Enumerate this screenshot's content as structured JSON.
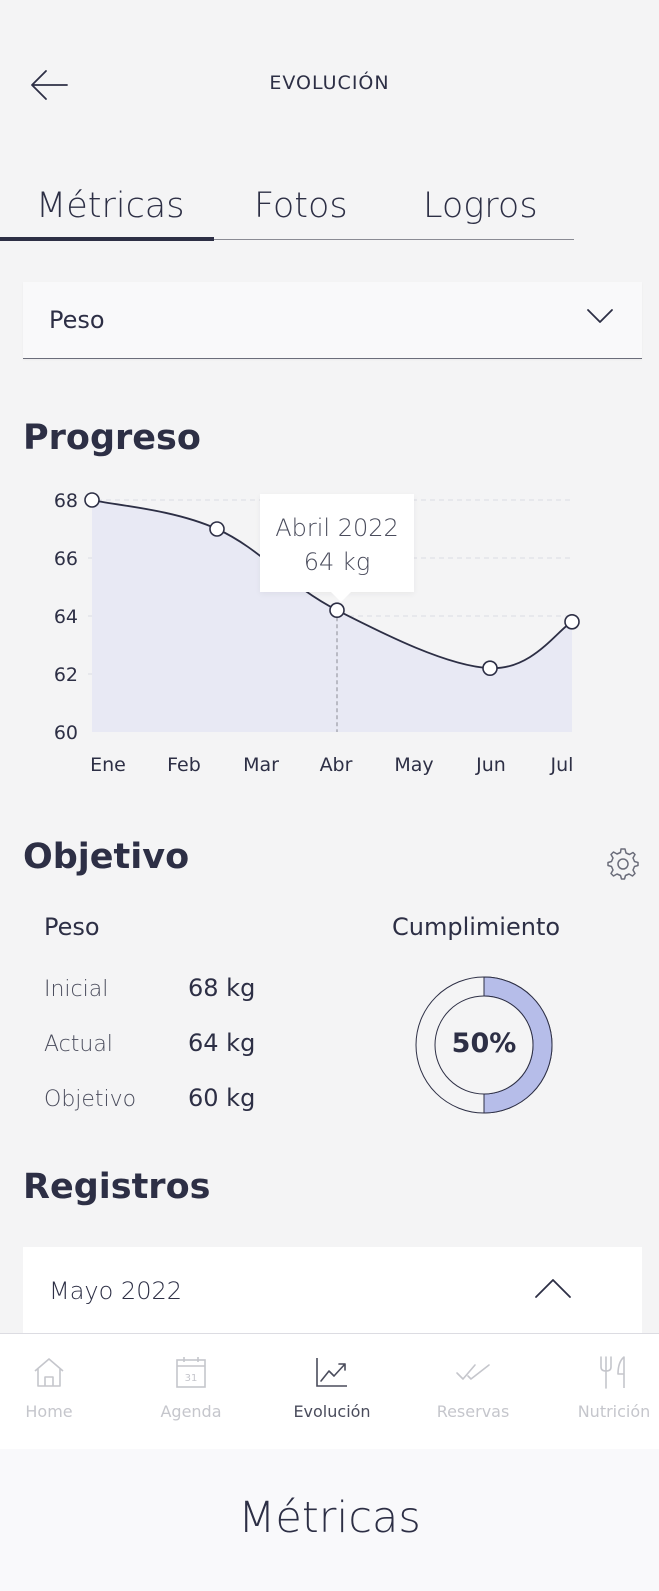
{
  "header": {
    "title": "EVOLUCIÓN",
    "back_icon": "arrow-left-icon"
  },
  "tabs": [
    {
      "label": "Métricas",
      "active": true
    },
    {
      "label": "Fotos",
      "active": false
    },
    {
      "label": "Logros",
      "active": false
    }
  ],
  "metric_select": {
    "value": "Peso",
    "icon": "chevron-down-icon"
  },
  "progress": {
    "title": "Progreso"
  },
  "chart_data": {
    "type": "area",
    "categories": [
      "Ene",
      "Feb",
      "Mar",
      "Abr",
      "May",
      "Jun",
      "Jul"
    ],
    "series": [
      {
        "values": [
          68,
          67,
          null,
          64.2,
          null,
          62.2,
          63.8
        ]
      }
    ],
    "y_ticks": [
      68,
      66,
      64,
      62,
      60
    ],
    "ylim": [
      60,
      68
    ],
    "grid": true,
    "tooltip": {
      "line1": "Abril 2022",
      "line2": "64 kg",
      "category": "Abr"
    },
    "colors": {
      "line": "#2d2f45",
      "fill": "#e8e9f4",
      "grid": "#dadbe3"
    }
  },
  "objetivo": {
    "title": "Objetivo",
    "settings_icon": "gear-icon",
    "metric_label": "Peso",
    "rows": [
      {
        "label": "Inicial",
        "value": "68 kg"
      },
      {
        "label": "Actual",
        "value": "64 kg"
      },
      {
        "label": "Objetivo",
        "value": "60 kg"
      }
    ],
    "cumplimiento_label": "Cumplimiento",
    "cumplimiento_value": "50%",
    "cumplimiento_fraction": 0.5,
    "colors": {
      "progress": "#b6bde9",
      "track": "#f4f4f5",
      "stroke": "#2d2f45"
    }
  },
  "registros": {
    "title": "Registros",
    "accordion_label": "Mayo 2022",
    "accordion_icon": "chevron-up-icon"
  },
  "bottom_nav": [
    {
      "label": "Home",
      "icon": "home-icon",
      "active": false
    },
    {
      "label": "Agenda",
      "icon": "calendar-icon",
      "calendar_day": "31",
      "active": false
    },
    {
      "label": "Evolución",
      "icon": "trend-chart-icon",
      "active": true
    },
    {
      "label": "Reservas",
      "icon": "double-check-icon",
      "active": false
    },
    {
      "label": "Nutrición",
      "icon": "fork-knife-icon",
      "active": false
    }
  ],
  "caption": "Métricas"
}
